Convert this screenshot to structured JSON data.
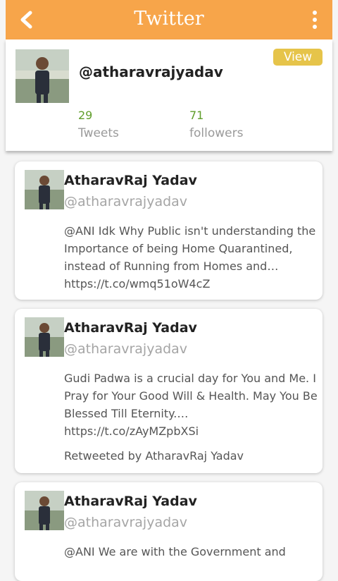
{
  "appbar": {
    "title": "Twitter"
  },
  "profile": {
    "handle": "@atharavrajyadav",
    "view_label": "View",
    "tweets_count": "29",
    "tweets_label": "Tweets",
    "followers_count": "71",
    "followers_label": "followers"
  },
  "tweets": [
    {
      "name": "AtharavRaj Yadav",
      "username": "@atharavrajyadav",
      "text": "@ANI Idk Why Public isn't understanding the Importance of being Home Quarantined, instead of Running from Homes and… https://t.co/wmq51oW4cZ"
    },
    {
      "name": "AtharavRaj Yadav",
      "username": "@atharavrajyadav",
      "text": "Gudi Padwa is a crucial day for You and Me. I Pray for Your Good Will & Health. May You Be Blessed Till Eternity.… https://t.co/zAyMZpbXSi",
      "retweeted_by": "Retweeted by AtharavRaj Yadav"
    },
    {
      "name": "AtharavRaj Yadav",
      "username": "@atharavrajyadav",
      "text": "@ANI We are with the Government and"
    }
  ],
  "icons": {
    "back": "back-arrow-icon",
    "menu": "more-vertical-icon"
  },
  "colors": {
    "appbar": "#f7a54a",
    "view_button": "#e6c44a",
    "count": "#5f9d2a"
  }
}
